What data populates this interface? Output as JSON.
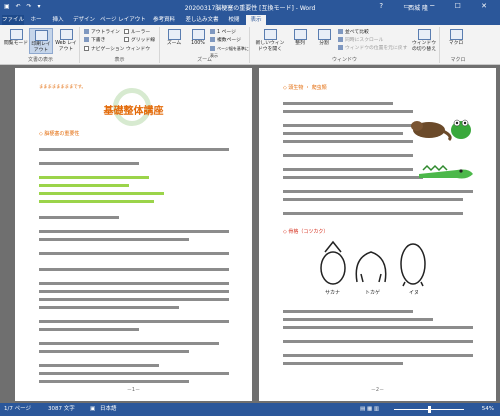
{
  "titlebar": {
    "title": "20200317脳梗塞の重要性 [互換モード] - Word",
    "user": "西城 隆",
    "qat_icons": "▣ ↶ ↷ ▾",
    "window_buttons": "? ▭ ─ ☐ ✕"
  },
  "tabs": [
    "ファイル",
    "ホーム",
    "挿入",
    "デザイン",
    "ページ レイアウト",
    "参考資料",
    "差し込み文書",
    "校閲",
    "表示"
  ],
  "ribbon": {
    "groups": {
      "views": "文書の表示",
      "show": "表示",
      "zoom": "ズーム",
      "window": "ウィンドウ",
      "macro": "マクロ"
    },
    "buttons": {
      "read_mode": "閲覧モード",
      "print_layout": "印刷レイアウト",
      "web_layout": "Web レイアウト",
      "outline": "アウトライン",
      "draft": "下書き",
      "ruler": "ルーラー",
      "gridlines": "グリッド線",
      "nav_pane": "ナビゲーション ウィンドウ",
      "zoom": "ズーム",
      "zoom100": "100%",
      "one_page": "1 ページ",
      "multi_page": "複数ページ",
      "page_width": "ページ幅を基準に表示",
      "new_window": "新しいウィンドウを開く",
      "arrange_all": "整列",
      "split": "分割",
      "side_by_side": "並べて比較",
      "sync_scroll": "同時にスクロール",
      "reset_pos": "ウィンドウの位置を元に戻す",
      "switch_windows": "ウィンドウの切り替え",
      "macro": "マクロ"
    }
  },
  "page1": {
    "header_label": "ままままままままです。",
    "title": "基礎整体講座",
    "heading1": "◇ 脳梗塞の重要性",
    "green_lines": [
      "脳梗塞は生活に…",
      "適切な…",
      "早めの対応を…",
      "予防のために…"
    ],
    "page_number": "－1－"
  },
  "page2": {
    "heading1": "◇ 頭生物 ・ 爬虫類",
    "heading2": "◇ 骨格（コツカク）",
    "labels": [
      "サカナ",
      "トカゲ",
      "イヌ"
    ],
    "page_number": "－2－"
  },
  "statusbar": {
    "page": "1/7 ページ",
    "words": "3087 文字",
    "language": "日本語",
    "zoom": "54%"
  }
}
